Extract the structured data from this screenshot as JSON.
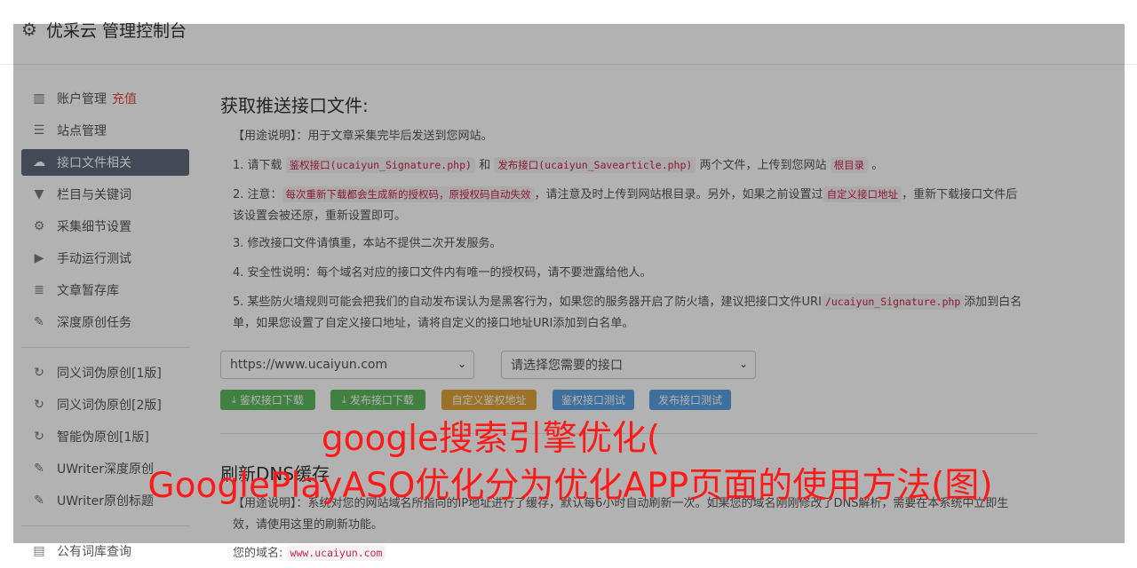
{
  "brand": {
    "title": "优采云 管理控制台"
  },
  "sidebar": {
    "items": [
      {
        "label": "账户管理",
        "extra": "充值",
        "icon": "bar-chart-icon"
      },
      {
        "label": "站点管理",
        "icon": "list-icon"
      },
      {
        "label": "接口文件相关",
        "icon": "cloud-upload-icon",
        "active": true
      },
      {
        "label": "栏目与关键词",
        "icon": "filter-icon"
      },
      {
        "label": "采集细节设置",
        "icon": "gears-icon"
      },
      {
        "label": "手动运行测试",
        "icon": "play-icon"
      },
      {
        "label": "文章暂存库",
        "icon": "database-icon"
      },
      {
        "label": "深度原创任务",
        "icon": "edit-icon"
      },
      {
        "label": "同义词伪原创[1版]",
        "icon": "refresh-icon"
      },
      {
        "label": "同义词伪原创[2版]",
        "icon": "refresh-icon"
      },
      {
        "label": "智能伪原创[1版]",
        "icon": "refresh-icon"
      },
      {
        "label": "UWriter深度原创",
        "icon": "edit-icon"
      },
      {
        "label": "UWriter原创标题",
        "icon": "edit-icon"
      },
      {
        "label": "公有词库查询",
        "icon": "book-icon"
      }
    ]
  },
  "section1": {
    "title": "获取推送接口文件:",
    "usage": "【用途说明】：用于文章采集完毕后发送到您网站。",
    "p1_pre": "1. 请下载",
    "p1_code1": "鉴权接口(ucaiyun_Signature.php)",
    "p1_mid": "和",
    "p1_code2": "发布接口(ucaiyun_Savearticle.php)",
    "p1_post": "两个文件，上传到您网站",
    "p1_code3": "根目录",
    "p1_end": "。",
    "p2_pre": "2. 注意：",
    "p2_code1": "每次重新下载都会生成新的授权码，原授权码自动失效",
    "p2_mid": "，请注意及时上传到网站根目录。另外，如果之前设置过",
    "p2_code2": "自定义接口地址",
    "p2_post": "，重新下载接口文件后该设置会被还原，重新设置即可。",
    "p3": "3. 修改接口文件请慎重，本站不提供二次开发服务。",
    "p4": "4. 安全性说明：每个域名对应的接口文件内有唯一的授权码，请不要泄露给他人。",
    "p5_pre": "5. 某些防火墙规则可能会把我们的自动发布误认为是黑客行为，如果您的服务器开启了防火墙，建议把接口文件URI",
    "p5_code": "/ucaiyun_Signature.php",
    "p5_post": "添加到白名单，如果您设置了自定义接口地址，请将自定义的接口地址URI添加到白名单。"
  },
  "controls": {
    "site_select": "https://www.ucaiyun.com",
    "api_select": "请选择您需要的接口",
    "buttons": [
      {
        "label": "鉴权接口下载",
        "style": "green",
        "icon": "download-icon"
      },
      {
        "label": "发布接口下载",
        "style": "green",
        "icon": "download-icon"
      },
      {
        "label": "自定义鉴权地址",
        "style": "orange"
      },
      {
        "label": "鉴权接口测试",
        "style": "blue"
      },
      {
        "label": "发布接口测试",
        "style": "blue"
      }
    ]
  },
  "section2": {
    "title": "刷新DNS缓存",
    "usage": "【用途说明】：系统对您的网站域名所指向的IP地址进行了缓存，默认每6小时自动刷新一次。如果您的域名刚刚修改了DNS解析，需要在本系统中立即生效，请使用这里的刷新功能。",
    "domain_label": "您的域名:",
    "domain_value": "www.ucaiyun.com"
  },
  "ad_overlay": {
    "line1": "google搜索引擎优化(",
    "line2": "GooglePlayASO优化分为优化APP页面的使用方法(图)"
  }
}
